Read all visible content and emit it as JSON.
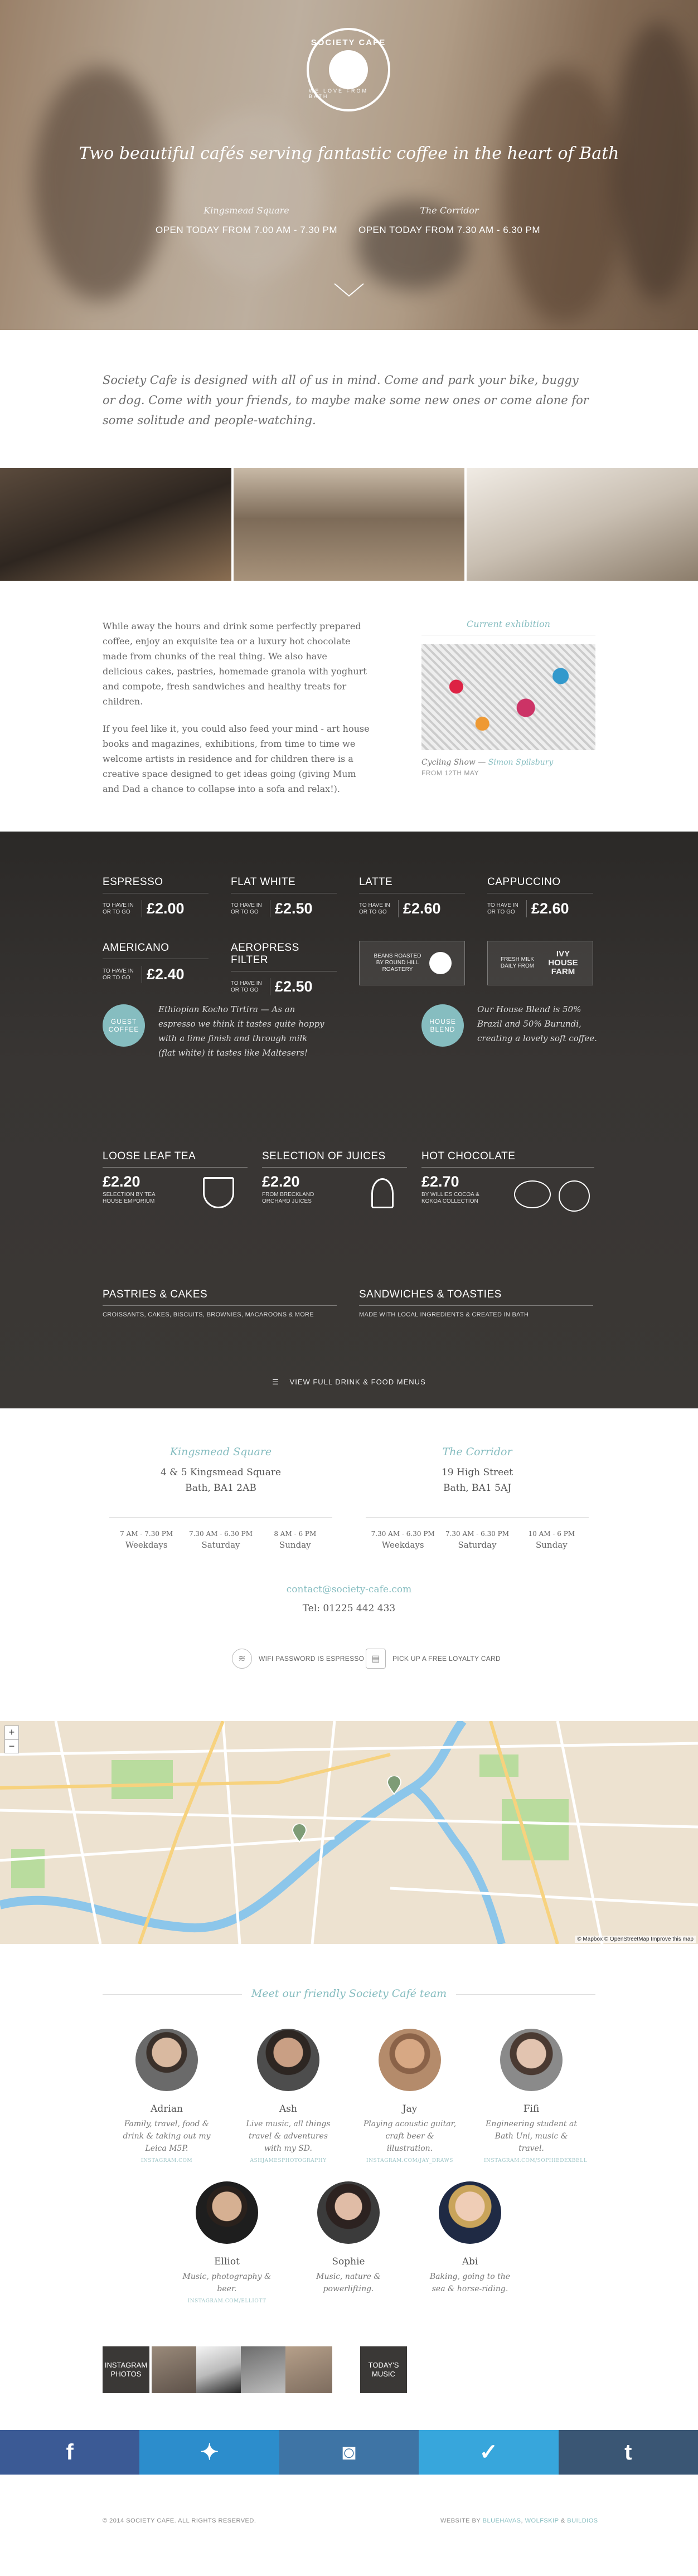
{
  "hero": {
    "logo_top": "SOCIETY CAFE",
    "logo_bottom": "WE LOVE FROM BATH",
    "tagline": "Two beautiful cafés serving fantastic coffee in the heart of Bath",
    "locations": [
      {
        "name": "Kingsmead Square",
        "hours": "OPEN TODAY FROM 7.00 AM - 7.30 PM"
      },
      {
        "name": "The Corridor",
        "hours": "OPEN TODAY FROM 7.30 AM - 6.30 PM"
      }
    ]
  },
  "intro": "Society Cafe is designed with all of us in mind. Come and park your bike, buggy or dog. Come with your friends, to maybe make some new ones or come alone for some solitude and people-watching.",
  "about": {
    "p1": "While away the hours and drink some perfectly prepared coffee, enjoy an exquisite tea or a luxury hot chocolate made from chunks of the real thing. We also have delicious cakes, pastries, homemade granola with yoghurt and compote, fresh sandwiches and healthy treats for children.",
    "p2": "If you feel like it, you could also feed your mind - art house books and magazines, exhibitions, from time to time we welcome artists in residence and for children there is a creative space designed to get ideas going (giving Mum and Dad a chance to collapse into a sofa and relax!)."
  },
  "exhibition": {
    "heading": "Current exhibition",
    "caption": "Cycling Show —",
    "artist": "Simon Spilsbury",
    "date": "FROM 12TH MAY"
  },
  "menu": {
    "small_note": "TO HAVE IN OR TO GO",
    "drinks": [
      {
        "name": "ESPRESSO",
        "price": "£2.00"
      },
      {
        "name": "FLAT WHITE",
        "price": "£2.50"
      },
      {
        "name": "LATTE",
        "price": "£2.60"
      },
      {
        "name": "CAPPUCCINO",
        "price": "£2.60"
      },
      {
        "name": "AMERICANO",
        "price": "£2.40"
      },
      {
        "name": "AEROPRESS FILTER",
        "price": "£2.50"
      }
    ],
    "beans": "BEANS ROASTED BY ROUND HILL ROASTERY",
    "milk": "FRESH MILK DAILY FROM",
    "milk_brand": "IVY HOUSE FARM",
    "guest_badge": "GUEST COFFEE",
    "guest_desc": "Ethiopian Kocho Tirtira — As an espresso we think it tastes quite hoppy with a lime finish and through milk (flat white) it tastes like Maltesers!",
    "house_badge": "HOUSE BLEND",
    "house_desc": "Our House Blend is 50% Brazil and 50% Burundi, creating a lovely soft coffee.",
    "tea": {
      "name": "LOOSE LEAF TEA",
      "price": "£2.20",
      "note": "SELECTION BY TEA HOUSE EMPORIUM"
    },
    "juice": {
      "name": "SELECTION OF JUICES",
      "price": "£2.20",
      "note": "FROM BRECKLAND ORCHARD JUICES"
    },
    "choc": {
      "name": "HOT CHOCOLATE",
      "price": "£2.70",
      "note": "BY WILLIES COCOA & KOKOA COLLECTION"
    },
    "pastries": {
      "name": "PASTRIES & CAKES",
      "desc": "CROISSANTS, CAKES, BISCUITS, BROWNIES, MACAROONS & MORE"
    },
    "sandwiches": {
      "name": "SANDWICHES & TOASTIES",
      "desc": "MADE WITH LOCAL INGREDIENTS & CREATED IN BATH"
    },
    "full_menu": "VIEW FULL DRINK & FOOD MENUS"
  },
  "cafes": [
    {
      "name": "Kingsmead Square",
      "addr1": "4 & 5 Kingsmead Square",
      "addr2": "Bath, BA1 2AB",
      "hours": [
        {
          "t": "7 AM - 7.30 PM",
          "d": "Weekdays"
        },
        {
          "t": "7.30 AM - 6.30 PM",
          "d": "Saturday"
        },
        {
          "t": "8 AM - 6 PM",
          "d": "Sunday"
        }
      ]
    },
    {
      "name": "The Corridor",
      "addr1": "19 High Street",
      "addr2": "Bath, BA1 5AJ",
      "hours": [
        {
          "t": "7.30 AM - 6.30 PM",
          "d": "Weekdays"
        },
        {
          "t": "7.30 AM - 6.30 PM",
          "d": "Saturday"
        },
        {
          "t": "10 AM - 6 PM",
          "d": "Sunday"
        }
      ]
    }
  ],
  "contact": {
    "email": "contact@society-cafe.com",
    "tel": "Tel: 01225 442 433"
  },
  "wifi": "WIFI PASSWORD IS ESPRESSO",
  "loyalty": "PICK UP A FREE LOYALTY CARD",
  "map": {
    "attribution": "© Mapbox © OpenStreetMap Improve this map"
  },
  "team": {
    "title": "Meet our friendly Society Café team",
    "members": [
      {
        "name": "Adrian",
        "desc": "Family, travel, food & drink & taking out my Leica M5P.",
        "ig": "INSTAGRAM.COM"
      },
      {
        "name": "Ash",
        "desc": "Live music, all things travel & adventures with my SD.",
        "ig": "ASHJAMESPHOTOGRAPHY"
      },
      {
        "name": "Jay",
        "desc": "Playing acoustic guitar, craft beer & illustration.",
        "ig": "INSTAGRAM.COM/JAY_DRAWS"
      },
      {
        "name": "Fifi",
        "desc": "Engineering student at Bath Uni, music & travel.",
        "ig": "INSTAGRAM.COM/SOPHIEDEXBELL"
      },
      {
        "name": "Elliot",
        "desc": "Music, photography & beer.",
        "ig": "INSTAGRAM.COM/ELLIOTT"
      },
      {
        "name": "Sophie",
        "desc": "Music, nature & powerlifting.",
        "ig": ""
      },
      {
        "name": "Abi",
        "desc": "Baking, going to the sea & horse-riding.",
        "ig": ""
      }
    ]
  },
  "instagram": {
    "label": "INSTAGRAM PHOTOS",
    "music": "TODAY'S MUSIC"
  },
  "social": [
    {
      "icon": "facebook-icon",
      "glyph": "f",
      "color": "#3b5a95"
    },
    {
      "icon": "twitter-icon",
      "glyph": "✦",
      "color": "#2c8dcc"
    },
    {
      "icon": "instagram-icon",
      "glyph": "◙",
      "color": "#3e74a5"
    },
    {
      "icon": "foursquare-icon",
      "glyph": "✓",
      "color": "#37a6dc"
    },
    {
      "icon": "tumblr-icon",
      "glyph": "t",
      "color": "#3a5674"
    }
  ],
  "footer": {
    "copyright": "© 2014 SOCIETY CAFE. ALL RIGHTS RESERVED.",
    "by": "WEBSITE BY",
    "studio1": "BLUEHAVAS",
    "studio2": "WOLFSKIP",
    "amp": "&",
    "studio3": "BUILDIOS"
  }
}
